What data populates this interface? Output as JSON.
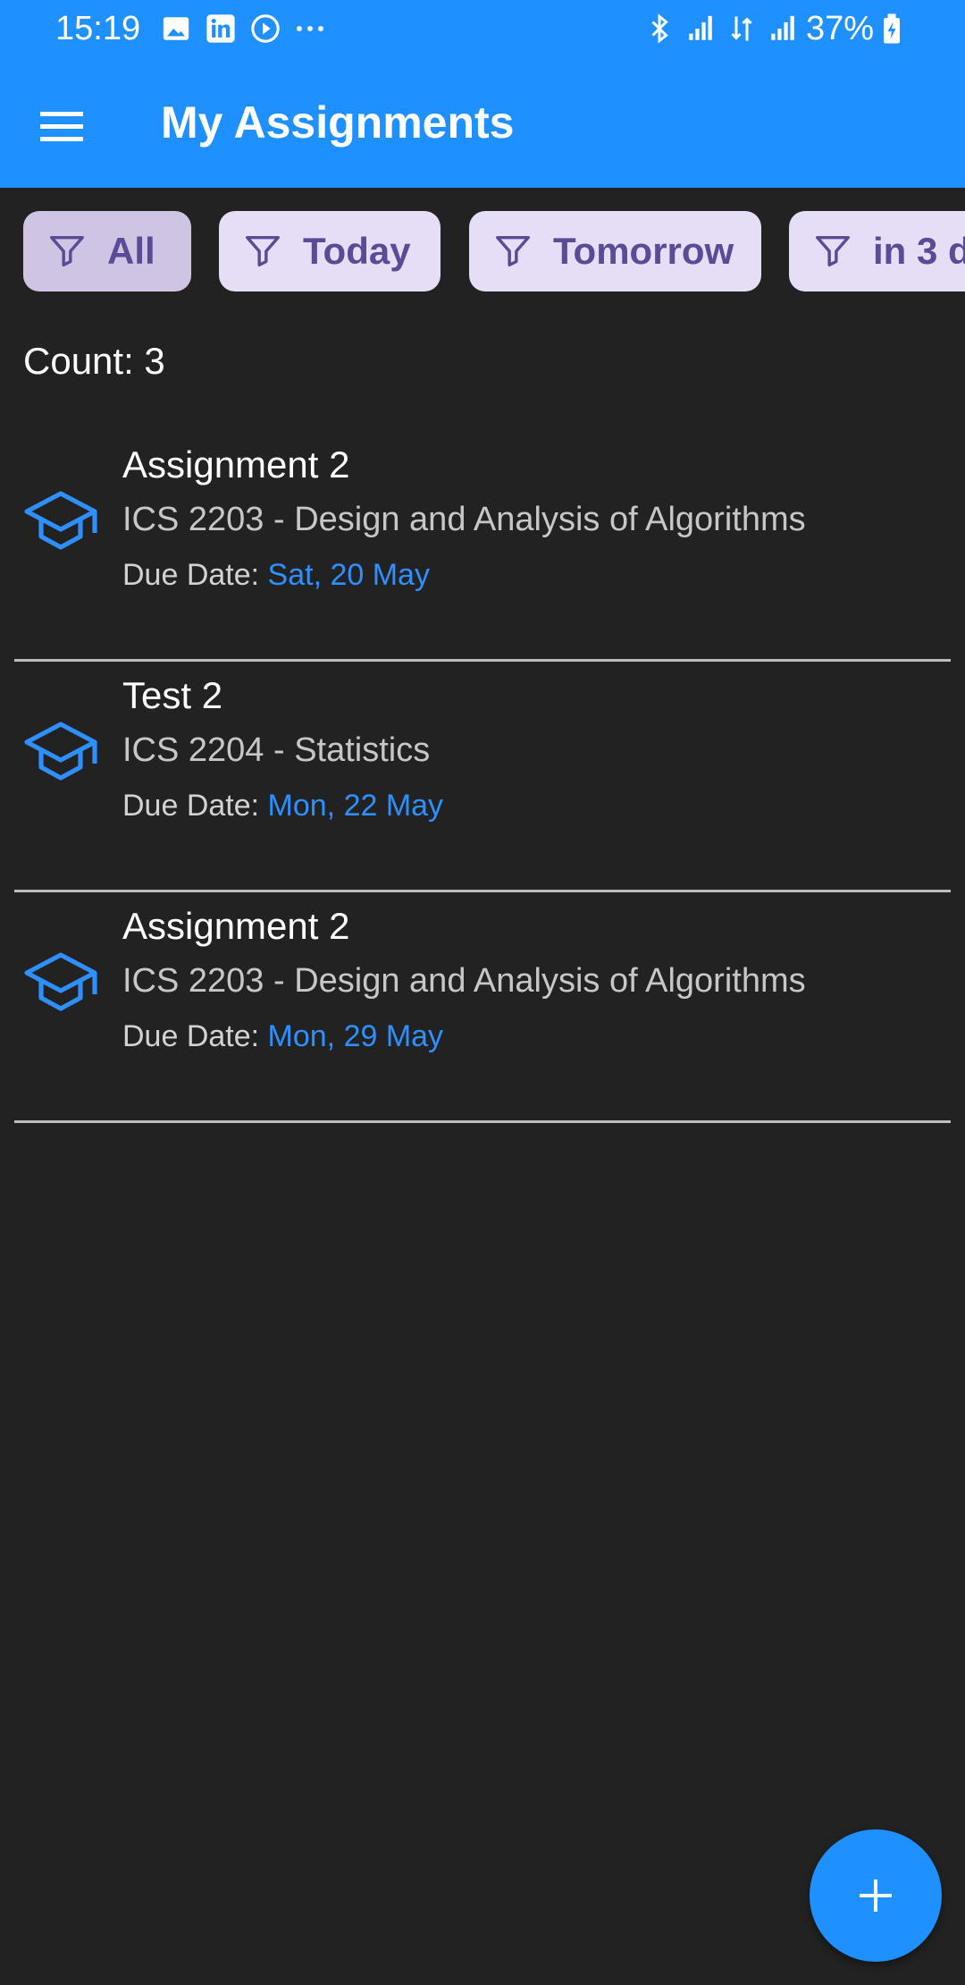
{
  "status_bar": {
    "time": "15:19",
    "battery": "37%",
    "left_icons": [
      "image-icon",
      "linkedin-icon",
      "play-icon",
      "more-dots-icon"
    ],
    "right_icons": [
      "bluetooth-icon",
      "signal-icon",
      "data-transfer-icon",
      "signal-icon",
      "battery-charging-icon"
    ]
  },
  "app_bar": {
    "menu_icon": "hamburger-menu-icon",
    "title": "My Assignments",
    "color": "#1e90ff"
  },
  "filters": [
    {
      "label": "All",
      "selected": true
    },
    {
      "label": "Today",
      "selected": false
    },
    {
      "label": "Tomorrow",
      "selected": false
    },
    {
      "label": "in 3 d",
      "selected": false
    }
  ],
  "count_text": "Count: 3",
  "assignments": [
    {
      "title": "Assignment 2",
      "course": "ICS 2203 - Design and Analysis of Algorithms",
      "due_label": "Due Date: ",
      "due_date": "Sat, 20 May"
    },
    {
      "title": "Test 2",
      "course": "ICS 2204 - Statistics",
      "due_label": "Due Date: ",
      "due_date": "Mon, 22 May"
    },
    {
      "title": "Assignment 2",
      "course": "ICS 2203 - Design and Analysis of Algorithms",
      "due_label": "Due Date: ",
      "due_date": "Mon, 29 May"
    }
  ],
  "fab": {
    "icon": "plus-icon"
  },
  "colors": {
    "primary": "#1e90ff",
    "background": "#222223",
    "chip_bg": "#e6ddf6",
    "chip_text": "#5b4a96",
    "due_date": "#2e8fff"
  }
}
